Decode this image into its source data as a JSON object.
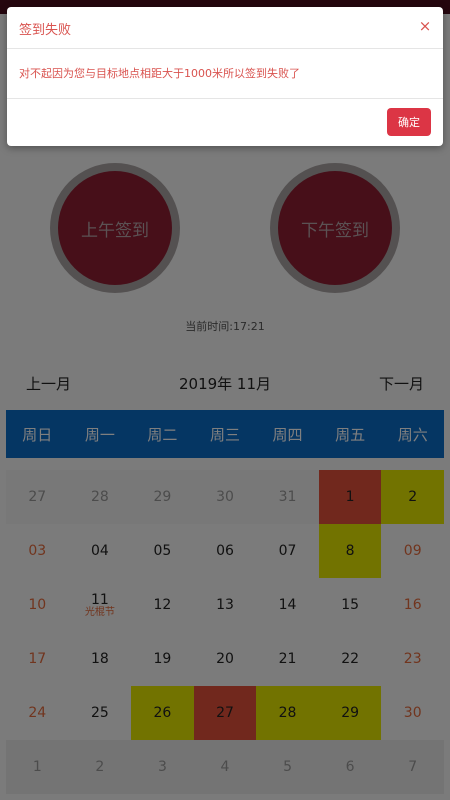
{
  "modal": {
    "title": "签到失败",
    "close_symbol": "×",
    "message": "对不起因为您与目标地点相距大于1000米所以签到失败了",
    "ok_label": "确定"
  },
  "sign_in": {
    "am_label": "上午签到",
    "pm_label": "下午签到",
    "current_time": "当前时间:17:21"
  },
  "calendar": {
    "prev_label": "上一月",
    "month_title": "2019年 11月",
    "next_label": "下一月",
    "weekdays": [
      "周日",
      "周一",
      "周二",
      "周三",
      "周四",
      "周五",
      "周六"
    ],
    "rows": [
      [
        {
          "d": "27",
          "t": "muted"
        },
        {
          "d": "28",
          "t": "muted"
        },
        {
          "d": "29",
          "t": "muted"
        },
        {
          "d": "30",
          "t": "muted"
        },
        {
          "d": "31",
          "t": "muted"
        },
        {
          "d": "1",
          "t": "red"
        },
        {
          "d": "2",
          "t": "yellow"
        }
      ],
      [
        {
          "d": "03",
          "t": "weekend"
        },
        {
          "d": "04",
          "t": ""
        },
        {
          "d": "05",
          "t": ""
        },
        {
          "d": "06",
          "t": ""
        },
        {
          "d": "07",
          "t": ""
        },
        {
          "d": "8",
          "t": "yellow"
        },
        {
          "d": "09",
          "t": "weekend"
        }
      ],
      [
        {
          "d": "10",
          "t": "weekend"
        },
        {
          "d": "11",
          "t": "",
          "sub": "光棍节"
        },
        {
          "d": "12",
          "t": ""
        },
        {
          "d": "13",
          "t": ""
        },
        {
          "d": "14",
          "t": ""
        },
        {
          "d": "15",
          "t": ""
        },
        {
          "d": "16",
          "t": "weekend"
        }
      ],
      [
        {
          "d": "17",
          "t": "weekend"
        },
        {
          "d": "18",
          "t": ""
        },
        {
          "d": "19",
          "t": ""
        },
        {
          "d": "20",
          "t": ""
        },
        {
          "d": "21",
          "t": ""
        },
        {
          "d": "22",
          "t": ""
        },
        {
          "d": "23",
          "t": "weekend"
        }
      ],
      [
        {
          "d": "24",
          "t": "weekend"
        },
        {
          "d": "25",
          "t": ""
        },
        {
          "d": "26",
          "t": "yellow"
        },
        {
          "d": "27",
          "t": "red"
        },
        {
          "d": "28",
          "t": "yellow"
        },
        {
          "d": "29",
          "t": "yellow"
        },
        {
          "d": "30",
          "t": "weekend"
        }
      ],
      [
        {
          "d": "1",
          "t": "muted"
        },
        {
          "d": "2",
          "t": "muted"
        },
        {
          "d": "3",
          "t": "muted"
        },
        {
          "d": "4",
          "t": "muted"
        },
        {
          "d": "5",
          "t": "muted"
        },
        {
          "d": "6",
          "t": "muted"
        },
        {
          "d": "7",
          "t": "muted"
        }
      ]
    ]
  },
  "colors": {
    "weekday_header": "#0b6cc7",
    "signed_red": "#e3503a",
    "signed_yellow": "#e5e600",
    "primary_button": "#dc3545"
  }
}
